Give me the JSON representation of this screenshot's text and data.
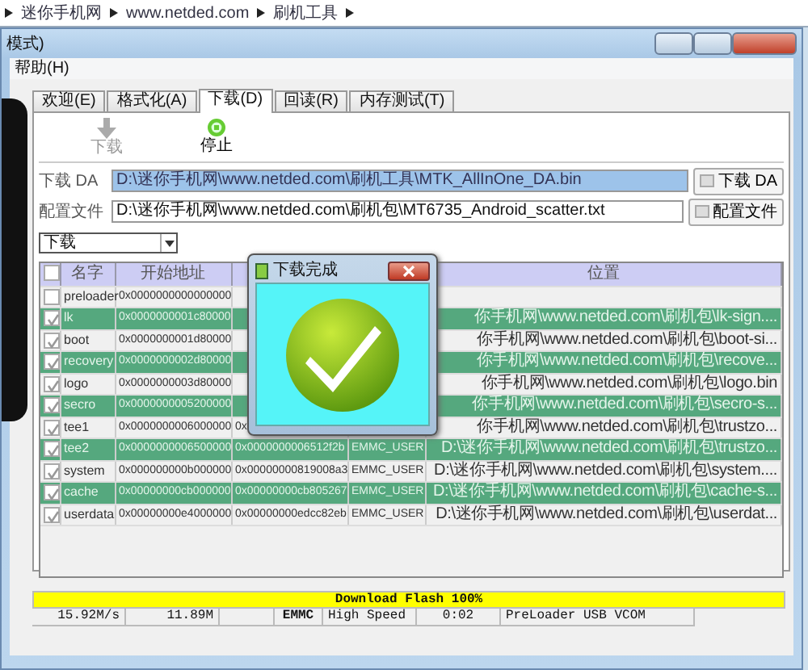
{
  "explorer": {
    "crumbs": [
      "迷你手机网",
      "www.netded.com",
      "刷机工具"
    ]
  },
  "window": {
    "title": "模式)"
  },
  "menu": [
    "帮助(H)"
  ],
  "tabs": [
    {
      "label": "欢迎(E)",
      "selected": false
    },
    {
      "label": "格式化(A)",
      "selected": false
    },
    {
      "label": "下载(D)",
      "selected": true
    },
    {
      "label": "回读(R)",
      "selected": false
    },
    {
      "label": "内存测试(T)",
      "selected": false
    }
  ],
  "toolbar": [
    {
      "kind": "download",
      "label": "下载",
      "disabled": true
    },
    {
      "kind": "stop",
      "label": "停止",
      "disabled": false
    }
  ],
  "da": {
    "label": "下载 DA",
    "value": "D:\\迷你手机网\\www.netded.com\\刷机工具\\MTK_AllInOne_DA.bin",
    "button": "下载 DA"
  },
  "scatter": {
    "label": "配置文件",
    "value": "D:\\迷你手机网\\www.netded.com\\刷机包\\MT6735_Android_scatter.txt",
    "button": "配置文件"
  },
  "mode_select": {
    "value": "下载"
  },
  "table": {
    "all_checked": false,
    "columns": {
      "name": "名字",
      "start": "开始地址",
      "location": "位置"
    },
    "rows": [
      {
        "name": "preloader",
        "start": "0x0000000000000000",
        "checked": false,
        "highlighted": false
      },
      {
        "name": "lk",
        "start": "0x0000000001c80000",
        "location": "你手机网\\www.netded.com\\刷机包\\lk-sign....",
        "checked": true,
        "highlighted": true
      },
      {
        "name": "boot",
        "start": "0x0000000001d80000",
        "location": "你手机网\\www.netded.com\\刷机包\\boot-si...",
        "checked": true,
        "highlighted": false
      },
      {
        "name": "recovery",
        "start": "0x0000000002d80000",
        "location": "你手机网\\www.netded.com\\刷机包\\recove...",
        "checked": true,
        "highlighted": true
      },
      {
        "name": "logo",
        "start": "0x0000000003d80000",
        "location": "你手机网\\www.netded.com\\刷机包\\logo.bin",
        "checked": true,
        "highlighted": false
      },
      {
        "name": "secro",
        "start": "0x0000000005200000",
        "location": "你手机网\\www.netded.com\\刷机包\\secro-s...",
        "checked": true,
        "highlighted": true
      },
      {
        "name": "tee1",
        "start": "0x0000000006000000",
        "end": "0x",
        "location": "你手机网\\www.netded.com\\刷机包\\trustzo...",
        "checked": true,
        "highlighted": false
      },
      {
        "name": "tee2",
        "start": "0x0000000006500000",
        "end": "0x0000000006512f2b",
        "region": "EMMC_USER",
        "location": "D:\\迷你手机网\\www.netded.com\\刷机包\\trustzo...",
        "checked": true,
        "highlighted": true
      },
      {
        "name": "system",
        "start": "0x000000000b000000",
        "end": "0x00000000819008a3",
        "region": "EMMC_USER",
        "location": "D:\\迷你手机网\\www.netded.com\\刷机包\\system....",
        "checked": true,
        "highlighted": false
      },
      {
        "name": "cache",
        "start": "0x00000000cb000000",
        "end": "0x00000000cb805267",
        "region": "EMMC_USER",
        "location": "D:\\迷你手机网\\www.netded.com\\刷机包\\cache-s...",
        "checked": true,
        "highlighted": true
      },
      {
        "name": "userdata",
        "start": "0x00000000e4000000",
        "end": "0x00000000edcc82eb",
        "region": "EMMC_USER",
        "location": "D:\\迷你手机网\\www.netded.com\\刷机包\\userdat...",
        "checked": true,
        "highlighted": false
      }
    ]
  },
  "dialog": {
    "title": "下载完成"
  },
  "progress": {
    "label": "Download Flash 100%",
    "level": 1
  },
  "status_bar": [
    {
      "text": "15.92M/s",
      "kind": "speed"
    },
    {
      "text": "11.89M",
      "kind": "size"
    },
    {
      "text": "EMMC",
      "kind": "storage"
    },
    {
      "text": "High Speed",
      "kind": "mode"
    },
    {
      "text": "0:02",
      "kind": "time"
    },
    {
      "text": "PreLoader USB VCOM",
      "kind": "port"
    }
  ]
}
